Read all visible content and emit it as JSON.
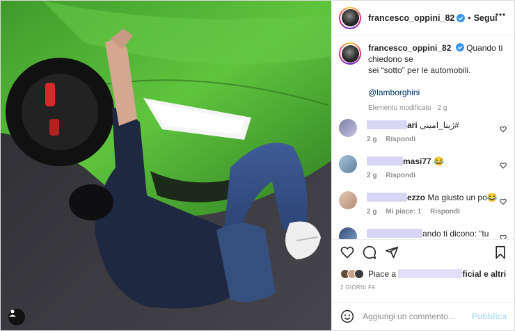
{
  "post": {
    "photo": {
      "alt_hidden": ""
    },
    "header": {
      "username": "francesco_oppini_82",
      "separator": "•",
      "follow_label": "Segui"
    },
    "caption": {
      "username": "francesco_oppini_82",
      "text_line1": "Quando ti chiedono se",
      "text_line2": "sei “sotto” per le automobili.",
      "mention": "@lamborghini",
      "meta": "Elemento modificato · 2 g"
    },
    "comments": [
      {
        "name_tail": "ari",
        "text": "ژینا_امینی#",
        "time": "2 g",
        "likes": "",
        "reply": "Rispondi"
      },
      {
        "name_tail": "masi77",
        "text": "😂",
        "time": "2 g",
        "likes": "",
        "reply": "Rispondi"
      },
      {
        "name_tail": "ezzo",
        "text": "Ma giusto un po😂",
        "time": "2 g",
        "likes": "Mi piace: 1",
        "reply": "Rispondi"
      },
      {
        "name_tail": "ando ti dicono: “tu",
        "text": "",
        "time": "",
        "likes": "",
        "reply": ""
      }
    ],
    "likes": {
      "prefix": "Piace a",
      "suffix_visible": "ficial",
      "and_others": "e altri"
    },
    "time_ago": "2 GIORNI FA",
    "add_comment": {
      "placeholder": "Aggiungi un commento...",
      "publish_label": "Pubblica"
    },
    "colors": {
      "link": "#00376b",
      "publish_disabled": "#b2dffc",
      "meta_gray": "#8e8e8e"
    },
    "icons": [
      "verified-badge-icon",
      "more-options-icon",
      "heart-icon",
      "comment-icon",
      "share-icon",
      "bookmark-icon",
      "emoji-icon",
      "user-tag-icon"
    ]
  }
}
